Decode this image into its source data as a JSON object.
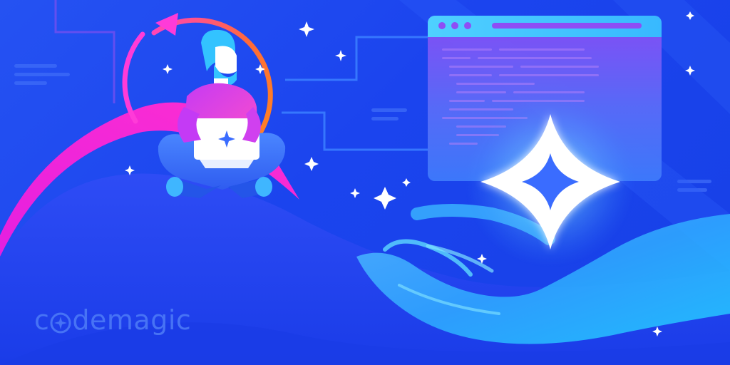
{
  "brand": {
    "name_prefix": "c",
    "name_suffix": "demagic",
    "logo_mark": "sparkle-icon"
  },
  "colors": {
    "background": "#1b44ee",
    "accent_magenta": "#e41fe0",
    "accent_orange": "#ff7a1a",
    "accent_cyan": "#3ad6ff",
    "sparkle": "#ffffff"
  },
  "scene": {
    "elements": [
      "developer-with-laptop",
      "refresh-cycle-arrow",
      "browser-window",
      "open-hand",
      "glowing-sparkle"
    ]
  }
}
